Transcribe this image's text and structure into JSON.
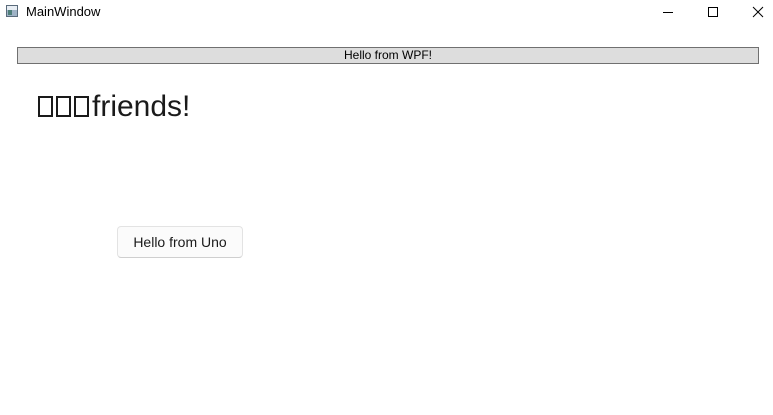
{
  "window": {
    "title": "MainWindow"
  },
  "wpf": {
    "banner_text": "Hello from WPF!"
  },
  "content": {
    "greeting_suffix": "friends!",
    "missing_glyph_count": 3
  },
  "uno": {
    "button_label": "Hello from Uno"
  },
  "icons": {
    "app": "app-window-icon",
    "minimize": "minimize-icon",
    "maximize": "maximize-icon",
    "close": "close-icon"
  }
}
